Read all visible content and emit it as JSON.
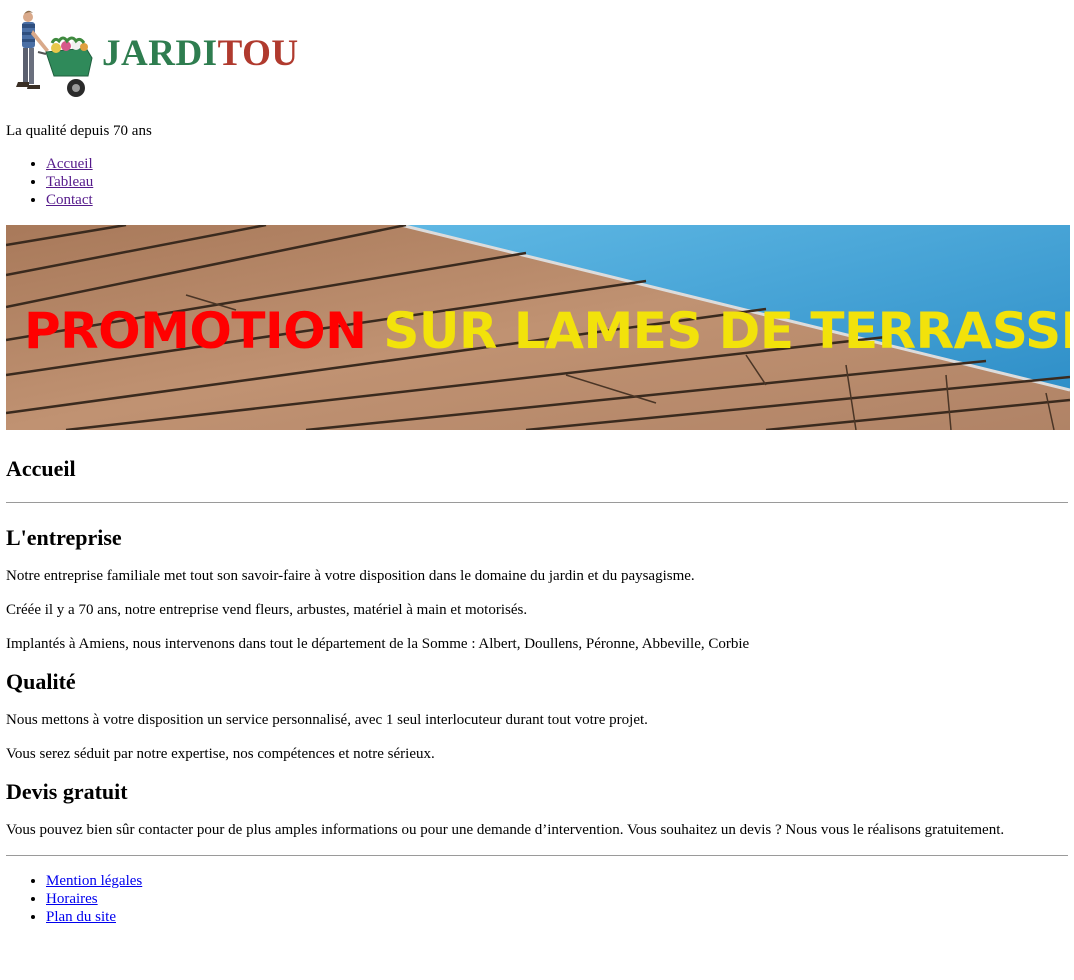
{
  "header": {
    "brand_part1": "JARDI",
    "brand_part2": "TOU",
    "brand_colors": {
      "part1": "#2e7d4f",
      "part2": "#b03a2e"
    },
    "logo_icon": "gardener-wheelbarrow-icon",
    "tagline": "La qualité depuis 70 ans"
  },
  "nav": {
    "items": [
      {
        "label": "Accueil"
      },
      {
        "label": "Tableau"
      },
      {
        "label": "Contact"
      }
    ],
    "link_color": "#551a8b"
  },
  "banner": {
    "text_red": "PROMOTION",
    "text_yellow": "SUR LAMES DE TERRASSE",
    "colors": {
      "red": "#ff0000",
      "yellow": "#f2e20b",
      "wood": "#b98a66",
      "pool": "#3aa3d8"
    }
  },
  "main": {
    "page_title": "Accueil",
    "sections": [
      {
        "heading": "L'entreprise",
        "paragraphs": [
          "Notre entreprise familiale met tout son savoir-faire à votre disposition dans le domaine du jardin et du paysagisme.",
          "Créée il y a 70 ans, notre entreprise vend fleurs, arbustes, matériel à main et motorisés.",
          "Implantés à Amiens, nous intervenons dans tout le département de la Somme : Albert, Doullens, Péronne, Abbeville, Corbie"
        ]
      },
      {
        "heading": "Qualité",
        "paragraphs": [
          "Nous mettons à votre disposition un service personnalisé, avec 1 seul interlocuteur durant tout votre projet.",
          "Vous serez séduit par notre expertise, nos compétences et notre sérieux."
        ]
      },
      {
        "heading": "Devis gratuit",
        "paragraphs": [
          "Vous pouvez bien sûr contacter pour de plus amples informations ou pour une demande d’intervention. Vous souhaitez un devis ? Nous vous le réalisons gratuitement."
        ]
      }
    ]
  },
  "footer": {
    "links": [
      {
        "label": "Mention légales"
      },
      {
        "label": "Horaires"
      },
      {
        "label": "Plan du site"
      }
    ],
    "link_color": "#0000ee"
  }
}
